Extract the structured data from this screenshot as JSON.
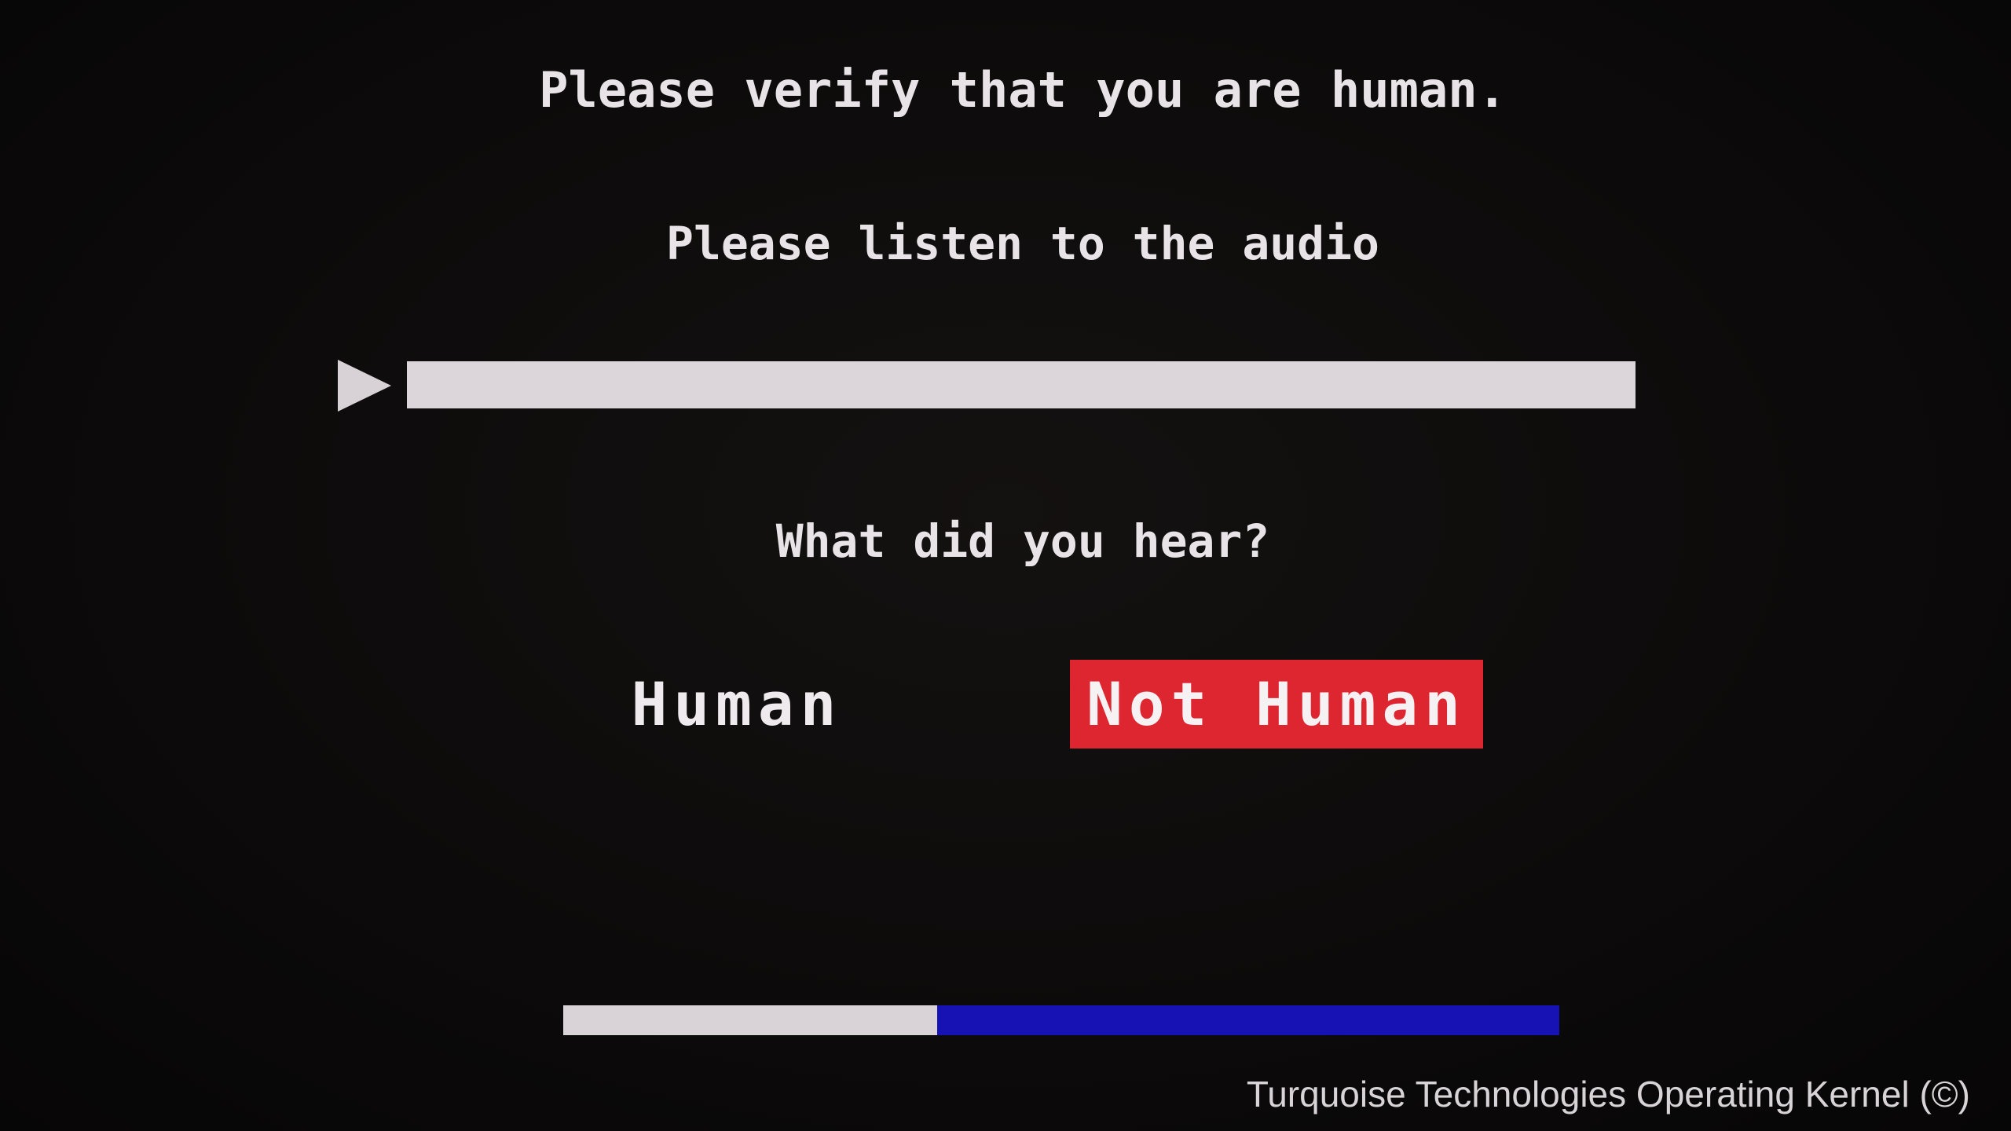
{
  "title": "Please verify that you are human.",
  "audio": {
    "prompt": "Please listen to the audio",
    "play_icon": "play-icon",
    "progress": 1.0
  },
  "question": "What did you hear?",
  "answers": {
    "human_label": "Human",
    "not_human_label": "Not Human",
    "selected": "Not Human"
  },
  "verification_progress": 0.375,
  "footer": "Turquoise Technologies Operating Kernel (©)",
  "colors": {
    "background": "#0b0909",
    "text": "#e8e3e6",
    "selected_answer": "#dd2630",
    "progress_remaining": "#1712b4",
    "progress_done": "#d9d3d7"
  }
}
